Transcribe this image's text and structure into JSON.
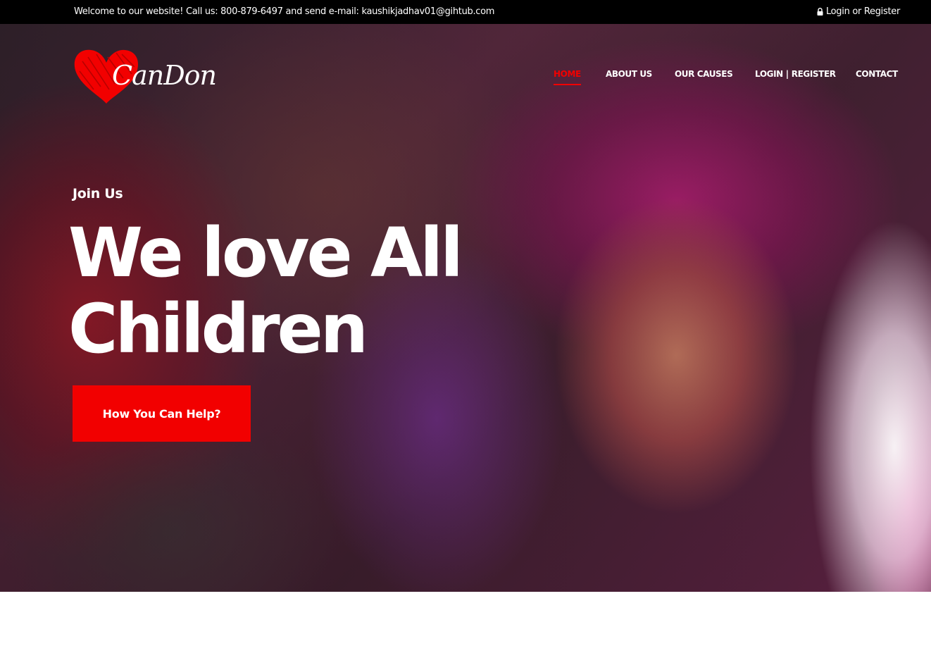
{
  "topbar": {
    "welcome_text": "Welcome to our website! Call us: 800-879-6497 and send e-mail: kaushikjadhav01@gihtub.com",
    "account_icon": "lock-icon",
    "account_text": "Login or Register"
  },
  "logo": {
    "icon": "heart-icon",
    "text": "CanDon"
  },
  "nav": {
    "items": [
      {
        "label": "HOME",
        "active": true
      },
      {
        "label": "ABOUT US",
        "active": false
      },
      {
        "label": "OUR CAUSES",
        "active": false
      },
      {
        "label": "LOGIN",
        "active": false
      },
      {
        "label": "REGISTER",
        "active": false
      },
      {
        "label": "CONTACT",
        "active": false
      }
    ],
    "separator": "|"
  },
  "hero": {
    "eyebrow": "Join Us",
    "headline_line1": "We love All",
    "headline_line2": "Children",
    "cta_label": "How You Can Help?"
  },
  "colors": {
    "accent": "#f20000",
    "topbar_bg": "#000000",
    "text_light": "#ffffff"
  }
}
